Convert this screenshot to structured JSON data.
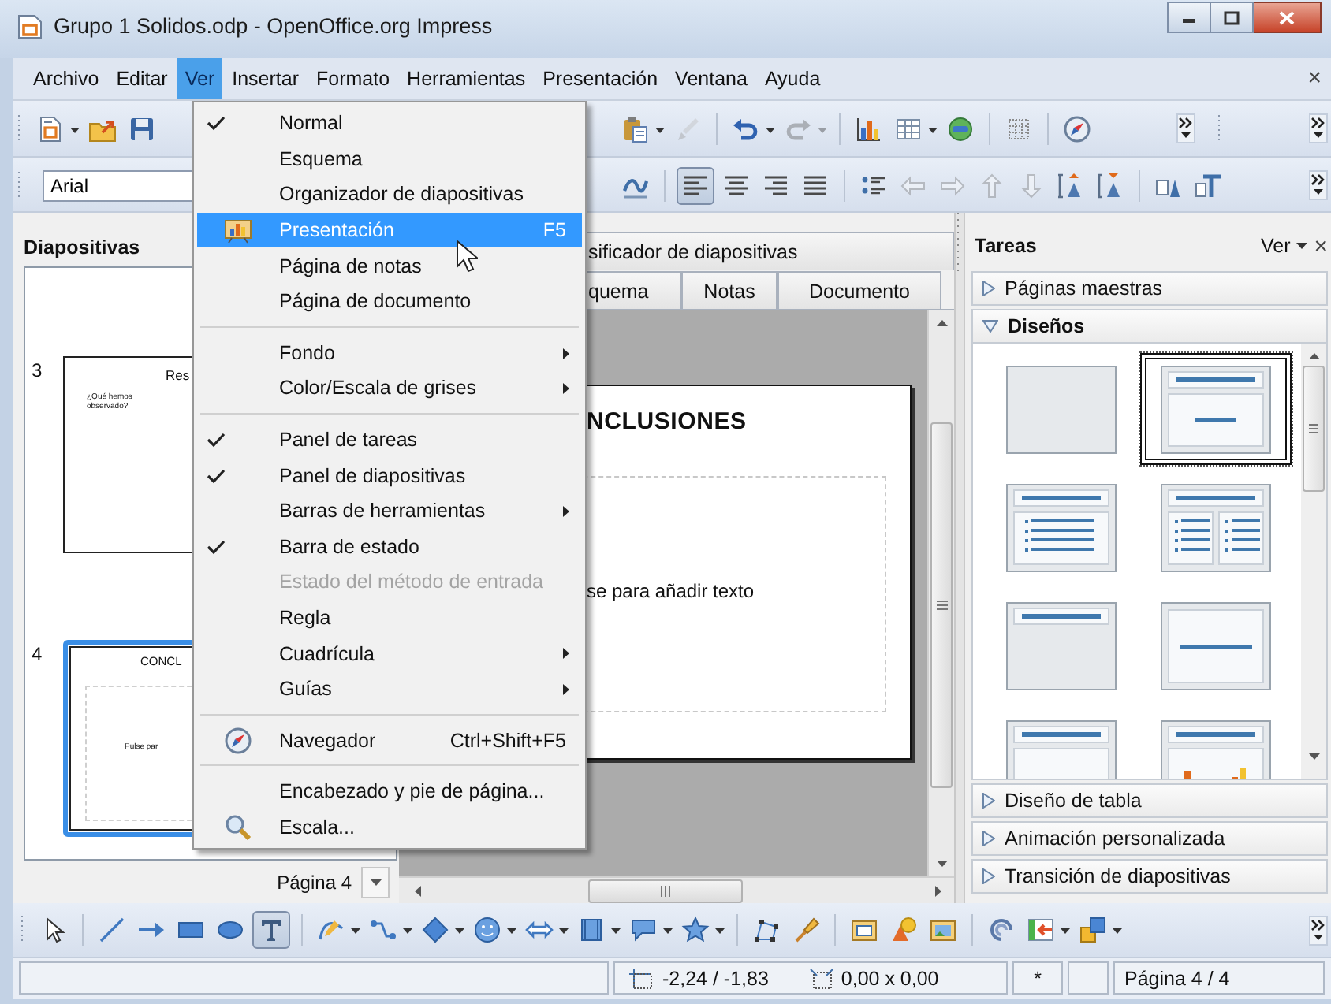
{
  "window": {
    "title": "Grupo 1 Solidos.odp - OpenOffice.org Impress"
  },
  "menubar": {
    "items": [
      {
        "label": "Archivo",
        "selected": false
      },
      {
        "label": "Editar",
        "selected": false
      },
      {
        "label": "Ver",
        "selected": true
      },
      {
        "label": "Insertar",
        "selected": false
      },
      {
        "label": "Formato",
        "selected": false
      },
      {
        "label": "Herramientas",
        "selected": false
      },
      {
        "label": "Presentación",
        "selected": false
      },
      {
        "label": "Ventana",
        "selected": false
      },
      {
        "label": "Ayuda",
        "selected": false
      }
    ],
    "close": "×"
  },
  "standard_toolbar": {
    "left": [
      {
        "kind": "grip"
      },
      {
        "kind": "new",
        "disabled": false
      },
      {
        "kind": "dropdown",
        "disabled": false
      },
      {
        "kind": "open",
        "disabled": false
      },
      {
        "kind": "save",
        "disabled": false
      }
    ],
    "right": [
      {
        "kind": "paste",
        "disabled": false
      },
      {
        "kind": "dropdown",
        "disabled": false
      },
      {
        "kind": "brush",
        "disabled": true
      },
      {
        "kind": "separator"
      },
      {
        "kind": "undo",
        "disabled": false
      },
      {
        "kind": "dropdown",
        "disabled": false
      },
      {
        "kind": "redo",
        "disabled": true
      },
      {
        "kind": "dropdown",
        "disabled": true
      },
      {
        "kind": "separator"
      },
      {
        "kind": "chart",
        "disabled": false
      },
      {
        "kind": "table",
        "disabled": false
      },
      {
        "kind": "dropdown",
        "disabled": false
      },
      {
        "kind": "globe",
        "disabled": false
      },
      {
        "kind": "separator"
      },
      {
        "kind": "grid",
        "disabled": false
      },
      {
        "kind": "separator"
      },
      {
        "kind": "navigator",
        "disabled": false
      },
      {
        "kind": "overflow"
      },
      {
        "kind": "grip"
      },
      {
        "kind": "overflow"
      }
    ]
  },
  "formatting_toolbar": {
    "left": [
      {
        "kind": "grip"
      },
      {
        "kind": "font-field",
        "value": "Arial"
      }
    ],
    "right": [
      {
        "kind": "fontwork",
        "disabled": false,
        "pressed": false
      },
      {
        "kind": "separator"
      },
      {
        "kind": "align-left",
        "disabled": false,
        "pressed": true
      },
      {
        "kind": "align-center",
        "disabled": false,
        "pressed": false
      },
      {
        "kind": "align-right",
        "disabled": false,
        "pressed": false
      },
      {
        "kind": "justify",
        "disabled": false,
        "pressed": false
      },
      {
        "kind": "separator"
      },
      {
        "kind": "bullets",
        "disabled": false,
        "pressed": false
      },
      {
        "kind": "promote",
        "disabled": true,
        "pressed": false
      },
      {
        "kind": "demote",
        "disabled": true,
        "pressed": false
      },
      {
        "kind": "move-up",
        "disabled": true,
        "pressed": false
      },
      {
        "kind": "move-down",
        "disabled": true,
        "pressed": false
      },
      {
        "kind": "spacing-up",
        "disabled": false,
        "pressed": false
      },
      {
        "kind": "spacing-down",
        "disabled": false,
        "pressed": false
      },
      {
        "kind": "separator"
      },
      {
        "kind": "char-frame",
        "disabled": false,
        "pressed": false
      },
      {
        "kind": "para-frame",
        "disabled": false,
        "pressed": false
      },
      {
        "kind": "overflow"
      }
    ]
  },
  "view_menu": {
    "items": [
      {
        "kind": "item",
        "label": "Normal",
        "checked": true,
        "selected": false,
        "disabled": false,
        "submenu": false
      },
      {
        "kind": "item",
        "label": "Esquema",
        "checked": false,
        "selected": false,
        "disabled": false,
        "submenu": false
      },
      {
        "kind": "item",
        "label": "Organizador de diapositivas",
        "checked": false,
        "selected": false,
        "disabled": false,
        "submenu": false
      },
      {
        "kind": "item",
        "label": "Presentación",
        "shortcut": "F5",
        "checked": false,
        "selected": true,
        "disabled": false,
        "submenu": false
      },
      {
        "kind": "item",
        "label": "Página de notas",
        "checked": false,
        "selected": false,
        "disabled": false,
        "submenu": false
      },
      {
        "kind": "item",
        "label": "Página de documento",
        "checked": false,
        "selected": false,
        "disabled": false,
        "submenu": false
      },
      {
        "kind": "separator"
      },
      {
        "kind": "item",
        "label": "Fondo",
        "checked": false,
        "selected": false,
        "disabled": false,
        "submenu": true
      },
      {
        "kind": "item",
        "label": "Color/Escala de grises",
        "checked": false,
        "selected": false,
        "disabled": false,
        "submenu": true
      },
      {
        "kind": "separator"
      },
      {
        "kind": "item",
        "label": "Panel de tareas",
        "checked": true,
        "selected": false,
        "disabled": false,
        "submenu": false
      },
      {
        "kind": "item",
        "label": "Panel de diapositivas",
        "checked": true,
        "selected": false,
        "disabled": false,
        "submenu": false
      },
      {
        "kind": "item",
        "label": "Barras de herramientas",
        "checked": false,
        "selected": false,
        "disabled": false,
        "submenu": true
      },
      {
        "kind": "item",
        "label": "Barra de estado",
        "checked": true,
        "selected": false,
        "disabled": false,
        "submenu": false
      },
      {
        "kind": "item",
        "label": "Estado del método de entrada",
        "checked": false,
        "selected": false,
        "disabled": true,
        "submenu": false
      },
      {
        "kind": "item",
        "label": "Regla",
        "checked": false,
        "selected": false,
        "disabled": false,
        "submenu": false
      },
      {
        "kind": "item",
        "label": "Cuadrícula",
        "checked": false,
        "selected": false,
        "disabled": false,
        "submenu": true
      },
      {
        "kind": "item",
        "label": "Guías",
        "checked": false,
        "selected": false,
        "disabled": false,
        "submenu": true
      },
      {
        "kind": "separator"
      },
      {
        "kind": "item",
        "label": "Navegador",
        "shortcut": "Ctrl+Shift+F5",
        "checked": false,
        "selected": false,
        "disabled": false,
        "submenu": false
      },
      {
        "kind": "separator"
      },
      {
        "kind": "item",
        "label": "Encabezado y pie de página...",
        "checked": false,
        "selected": false,
        "disabled": false,
        "submenu": false
      },
      {
        "kind": "item",
        "label": "Escala...",
        "checked": false,
        "selected": false,
        "disabled": false,
        "submenu": false
      }
    ]
  },
  "slides_panel": {
    "title": "Diapositivas",
    "slides": [
      {
        "number": "3",
        "title": "Res",
        "body": "¿Qué hemos observado?",
        "selected": false
      },
      {
        "number": "4",
        "title": "CONCL",
        "body": "Pulse par",
        "selected": true
      }
    ],
    "page_box": {
      "value": "Página 4"
    }
  },
  "editor": {
    "tabs_top": [
      {
        "label": "sificador de diapositivas",
        "selected": false
      }
    ],
    "tabs": [
      {
        "label": "quema",
        "selected": false
      },
      {
        "label": "Notas",
        "selected": false
      },
      {
        "label": "Documento",
        "selected": false
      }
    ],
    "slide": {
      "title": "NCLUSIONES",
      "body": "se para añadir texto"
    }
  },
  "task_pane": {
    "title": "Tareas",
    "view_menu": "Ver",
    "close": "×",
    "sections": [
      {
        "label": "Páginas maestras",
        "expanded": false
      },
      {
        "label": "Diseños",
        "expanded": true,
        "layouts": [
          {
            "kind": "blank",
            "selected": false
          },
          {
            "kind": "title-content",
            "selected": true
          },
          {
            "kind": "title-list",
            "selected": false
          },
          {
            "kind": "two-lists",
            "selected": false
          },
          {
            "kind": "title-only",
            "selected": false
          },
          {
            "kind": "centered",
            "selected": false
          },
          {
            "kind": "title-box",
            "selected": false
          },
          {
            "kind": "title-chart",
            "selected": false
          }
        ]
      },
      {
        "label": "Diseño de tabla",
        "expanded": false
      },
      {
        "label": "Animación personalizada",
        "expanded": false
      },
      {
        "label": "Transición de diapositivas",
        "expanded": false
      }
    ]
  },
  "drawing_toolbar": {
    "items": [
      {
        "kind": "grip"
      },
      {
        "kind": "select",
        "pressed": false
      },
      {
        "kind": "separator"
      },
      {
        "kind": "line",
        "pressed": false
      },
      {
        "kind": "arrow",
        "pressed": false
      },
      {
        "kind": "rectangle",
        "pressed": false
      },
      {
        "kind": "ellipse",
        "pressed": false
      },
      {
        "kind": "text",
        "pressed": true
      },
      {
        "kind": "separator"
      },
      {
        "kind": "curve",
        "pressed": false
      },
      {
        "kind": "dropdown"
      },
      {
        "kind": "connector",
        "pressed": false
      },
      {
        "kind": "dropdown"
      },
      {
        "kind": "diamond",
        "pressed": false
      },
      {
        "kind": "dropdown"
      },
      {
        "kind": "smiley",
        "pressed": false
      },
      {
        "kind": "dropdown"
      },
      {
        "kind": "block-arrow",
        "pressed": false
      },
      {
        "kind": "dropdown"
      },
      {
        "kind": "flowchart",
        "pressed": false
      },
      {
        "kind": "dropdown"
      },
      {
        "kind": "callout",
        "pressed": false
      },
      {
        "kind": "dropdown"
      },
      {
        "kind": "star",
        "pressed": false
      },
      {
        "kind": "dropdown"
      },
      {
        "kind": "separator"
      },
      {
        "kind": "points",
        "pressed": false
      },
      {
        "kind": "glue",
        "pressed": false
      },
      {
        "kind": "separator"
      },
      {
        "kind": "fontwork-gallery",
        "pressed": false
      },
      {
        "kind": "shapes",
        "pressed": false
      },
      {
        "kind": "image",
        "pressed": false
      },
      {
        "kind": "separator"
      },
      {
        "kind": "rotate",
        "pressed": false
      },
      {
        "kind": "insert",
        "pressed": false
      },
      {
        "kind": "dropdown"
      },
      {
        "kind": "arrange",
        "pressed": false
      },
      {
        "kind": "dropdown"
      },
      {
        "kind": "overflow"
      }
    ]
  },
  "status_bar": {
    "position": "-2,24 / -1,83",
    "size": "0,00 x 0,00",
    "modified": "*",
    "page": "Página 4 / 4"
  }
}
